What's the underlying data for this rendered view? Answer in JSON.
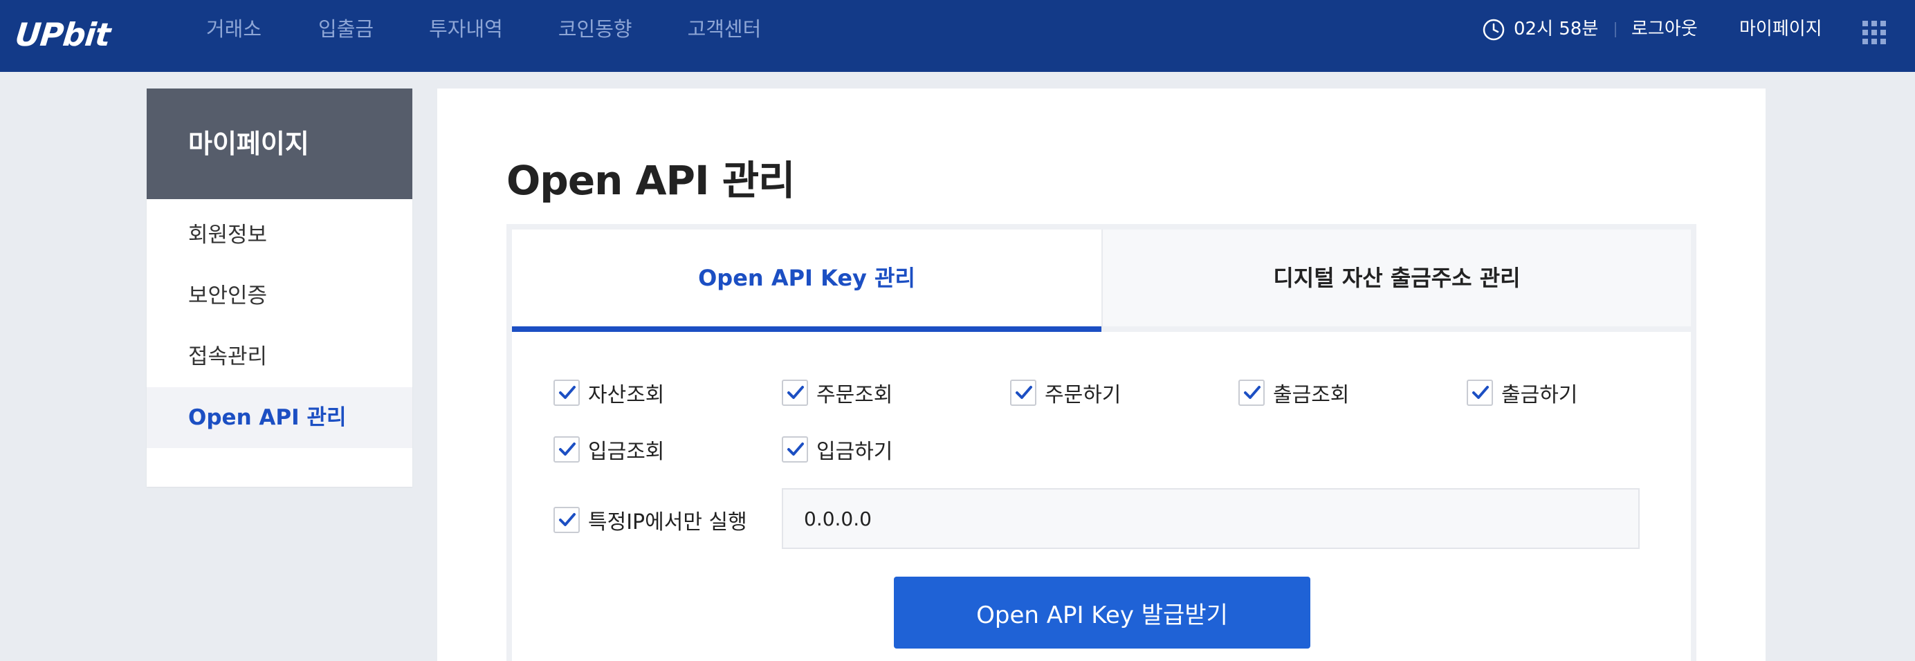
{
  "header": {
    "logo": "UPbit",
    "nav": [
      "거래소",
      "입출금",
      "투자내역",
      "코인동향",
      "고객센터"
    ],
    "clock": "02시 58분",
    "logout": "로그아웃",
    "mypage": "마이페이지"
  },
  "sidebar": {
    "title": "마이페이지",
    "items": [
      {
        "label": "회원정보"
      },
      {
        "label": "보안인증"
      },
      {
        "label": "접속관리"
      },
      {
        "label": "Open API 관리"
      }
    ]
  },
  "main": {
    "title": "Open API 관리",
    "tabs": [
      {
        "label": "Open API Key 관리"
      },
      {
        "label": "디지털 자산 출금주소 관리"
      }
    ],
    "permissions": [
      {
        "label": "자산조회",
        "checked": true
      },
      {
        "label": "주문조회",
        "checked": true
      },
      {
        "label": "주문하기",
        "checked": true
      },
      {
        "label": "출금조회",
        "checked": true
      },
      {
        "label": "출금하기",
        "checked": true
      },
      {
        "label": "입금조회",
        "checked": true
      },
      {
        "label": "입금하기",
        "checked": true
      }
    ],
    "ip_restriction": {
      "label": "특정IP에서만 실행",
      "checked": true,
      "value": "0.0.0.0"
    },
    "issue_button": "Open API Key 발급받기"
  },
  "colors": {
    "header_bg": "#133a88",
    "accent": "#1c4fc3",
    "button_bg": "#1f62d6",
    "sidebar_head_bg": "#565d6b"
  }
}
